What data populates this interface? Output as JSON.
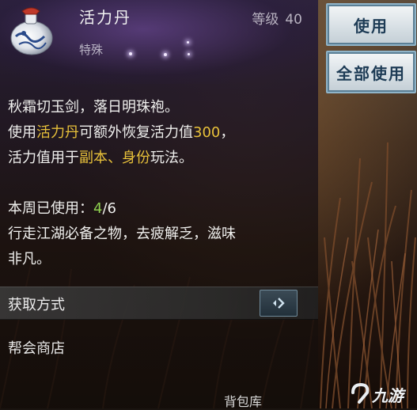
{
  "item": {
    "name": "活力丹",
    "type": "特殊",
    "level_label": "等级",
    "level_value": "40",
    "icon": "potion-bottle-icon"
  },
  "description": {
    "line1": "秋霜切玉剑，落日明珠袍。",
    "line2_a": "使用",
    "line2_b": "活力丹",
    "line2_c": "可额外恢复活力值",
    "line2_d": "300",
    "line2_e": "，",
    "line3_a": "活力值用于",
    "line3_b": "副本、身份",
    "line3_c": "玩法。",
    "used_label": "本周已使用：",
    "used_current": "4",
    "used_sep": "/",
    "used_max": "6",
    "line5": "行走江湖必备之物，去疲解乏，滋味",
    "line6": "非凡。"
  },
  "acquire": {
    "title": "获取方式",
    "source": "帮会商店",
    "go_icon": "arrow-right-icon"
  },
  "buttons": {
    "use": "使用",
    "use_all": "全部使用"
  },
  "footer": {
    "label": "背包库"
  },
  "watermark": {
    "text": "九游"
  },
  "colors": {
    "highlight_gold": "#e8c13a",
    "highlight_green": "#8fd14f",
    "button_text": "#1d3b55"
  }
}
